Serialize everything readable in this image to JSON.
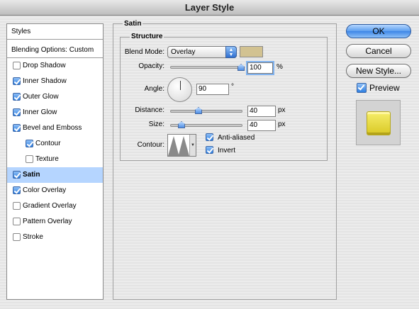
{
  "window": {
    "title": "Layer Style"
  },
  "styles_panel": {
    "header": "Styles",
    "blending": "Blending Options: Custom",
    "items": [
      {
        "label": "Drop Shadow",
        "checked": false,
        "indent": false,
        "selected": false
      },
      {
        "label": "Inner Shadow",
        "checked": true,
        "indent": false,
        "selected": false
      },
      {
        "label": "Outer Glow",
        "checked": true,
        "indent": false,
        "selected": false
      },
      {
        "label": "Inner Glow",
        "checked": true,
        "indent": false,
        "selected": false
      },
      {
        "label": "Bevel and Emboss",
        "checked": true,
        "indent": false,
        "selected": false
      },
      {
        "label": "Contour",
        "checked": true,
        "indent": true,
        "selected": false
      },
      {
        "label": "Texture",
        "checked": false,
        "indent": true,
        "selected": false
      },
      {
        "label": "Satin",
        "checked": true,
        "indent": false,
        "selected": true
      },
      {
        "label": "Color Overlay",
        "checked": true,
        "indent": false,
        "selected": false
      },
      {
        "label": "Gradient Overlay",
        "checked": false,
        "indent": false,
        "selected": false
      },
      {
        "label": "Pattern Overlay",
        "checked": false,
        "indent": false,
        "selected": false
      },
      {
        "label": "Stroke",
        "checked": false,
        "indent": false,
        "selected": false
      }
    ]
  },
  "satin": {
    "group_title": "Satin",
    "structure_title": "Structure",
    "blend_mode": {
      "label": "Blend Mode:",
      "value": "Overlay",
      "color": "#d2c291"
    },
    "opacity": {
      "label": "Opacity:",
      "value": "100",
      "unit": "%",
      "level": 1.0
    },
    "angle": {
      "label": "Angle:",
      "value": "90",
      "unit": "°"
    },
    "distance": {
      "label": "Distance:",
      "value": "40",
      "unit": "px",
      "level": 0.4
    },
    "size": {
      "label": "Size:",
      "value": "40",
      "unit": "px",
      "level": 0.16
    },
    "contour": {
      "label": "Contour:"
    },
    "anti_aliased": {
      "label": "Anti-aliased",
      "checked": true
    },
    "invert": {
      "label": "Invert",
      "checked": true
    }
  },
  "buttons": {
    "ok": "OK",
    "cancel": "Cancel",
    "new_style": "New Style..."
  },
  "preview": {
    "label": "Preview",
    "checked": true
  }
}
